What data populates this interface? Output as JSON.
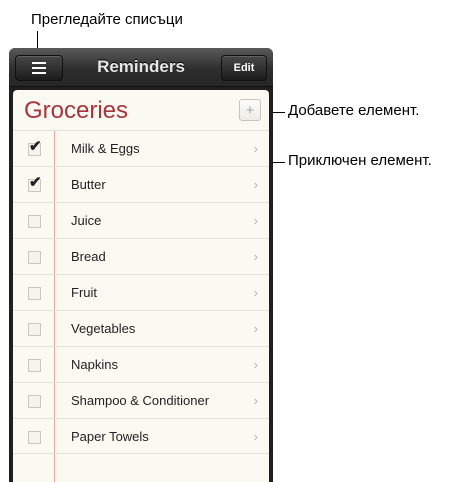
{
  "annotations": {
    "view_lists": "Прегледайте списъци",
    "add_item": "Добавете елемент.",
    "completed_item": "Приключен елемент."
  },
  "navbar": {
    "title": "Reminders",
    "edit_label": "Edit",
    "list_icon": "hamburger-icon"
  },
  "list": {
    "title": "Groceries",
    "add_label": "+",
    "accent_color": "#a8343c",
    "items": [
      {
        "label": "Milk & Eggs",
        "checked": true,
        "check": "✔"
      },
      {
        "label": "Butter",
        "checked": true,
        "check": "✔"
      },
      {
        "label": "Juice",
        "checked": false,
        "check": ""
      },
      {
        "label": "Bread",
        "checked": false,
        "check": ""
      },
      {
        "label": "Fruit",
        "checked": false,
        "check": ""
      },
      {
        "label": "Vegetables",
        "checked": false,
        "check": ""
      },
      {
        "label": "Napkins",
        "checked": false,
        "check": ""
      },
      {
        "label": "Shampoo & Conditioner",
        "checked": false,
        "check": ""
      },
      {
        "label": "Paper Towels",
        "checked": false,
        "check": ""
      }
    ],
    "chevron": "›"
  }
}
